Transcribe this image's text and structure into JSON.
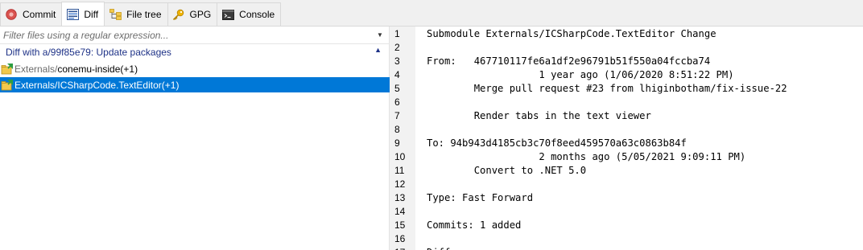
{
  "tabs": [
    {
      "label": "Commit",
      "icon": "commit-icon"
    },
    {
      "label": "Diff",
      "icon": "diff-icon",
      "active": true
    },
    {
      "label": "File tree",
      "icon": "file-tree-icon"
    },
    {
      "label": "GPG",
      "icon": "key-icon"
    },
    {
      "label": "Console",
      "icon": "console-icon"
    }
  ],
  "filter": {
    "placeholder": "Filter files using a regular expression..."
  },
  "group": {
    "label": "Diff with a/99f85e79: Update packages"
  },
  "files": [
    {
      "path": "Externals/",
      "name": "conemu-inside",
      "count": " (+1)"
    },
    {
      "path": "Externals/",
      "name": "ICSharpCode.TextEditor",
      "count": " (+1)",
      "selected": true
    }
  ],
  "diff_lines": [
    {
      "n": "1",
      "text": "Submodule Externals/ICSharpCode.TextEditor Change"
    },
    {
      "n": "2",
      "text": ""
    },
    {
      "n": "3",
      "text": "From:   467710117fe6a1df2e96791b51f550a04fccba74"
    },
    {
      "n": "4",
      "text": "                   1 year ago (1/06/2020 8:51:22 PM)"
    },
    {
      "n": "5",
      "text": "        Merge pull request #23 from lhiginbotham/fix-issue-22"
    },
    {
      "n": "6",
      "text": ""
    },
    {
      "n": "7",
      "text": "        Render tabs in the text viewer"
    },
    {
      "n": "8",
      "text": ""
    },
    {
      "n": "9",
      "text": "To: 94b943d4185cb3c70f8eed459570a63c0863b84f"
    },
    {
      "n": "10",
      "text": "                   2 months ago (5/05/2021 9:09:11 PM)"
    },
    {
      "n": "11",
      "text": "        Convert to .NET 5.0"
    },
    {
      "n": "12",
      "text": ""
    },
    {
      "n": "13",
      "text": "Type: Fast Forward"
    },
    {
      "n": "14",
      "text": ""
    },
    {
      "n": "15",
      "text": "Commits: 1 added"
    },
    {
      "n": "16",
      "text": ""
    },
    {
      "n": "17",
      "text": "Differences:"
    }
  ],
  "colors": {
    "selection": "#0078d7",
    "group_header": "#1e3287",
    "gutter": "#f2f2f2"
  }
}
